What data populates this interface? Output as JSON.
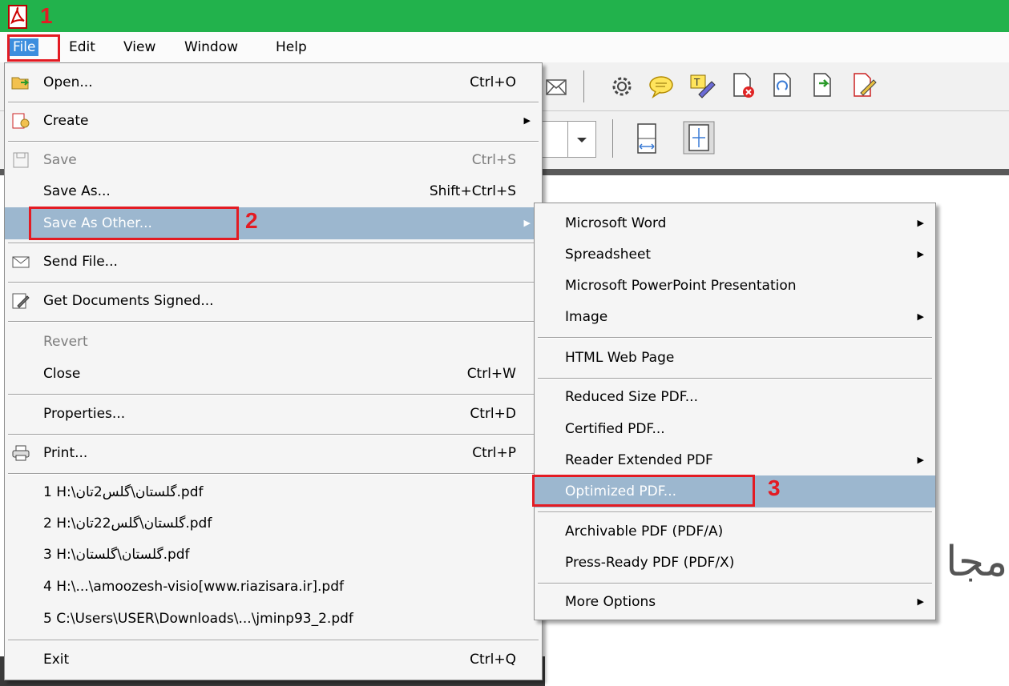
{
  "menubar": {
    "items": [
      {
        "label": "File"
      },
      {
        "label": "Edit"
      },
      {
        "label": "View"
      },
      {
        "label": "Window"
      },
      {
        "label": "Help"
      }
    ]
  },
  "file_menu": {
    "open": {
      "label": "Open...",
      "shortcut": "Ctrl+O"
    },
    "create": {
      "label": "Create"
    },
    "save": {
      "label": "Save",
      "shortcut": "Ctrl+S"
    },
    "save_as": {
      "label": "Save As...",
      "shortcut": "Shift+Ctrl+S"
    },
    "save_as_other": {
      "label": "Save As Other..."
    },
    "send_file": {
      "label": "Send File..."
    },
    "get_signed": {
      "label": "Get Documents Signed..."
    },
    "revert": {
      "label": "Revert"
    },
    "close": {
      "label": "Close",
      "shortcut": "Ctrl+W"
    },
    "properties": {
      "label": "Properties...",
      "shortcut": "Ctrl+D"
    },
    "print": {
      "label": "Print...",
      "shortcut": "Ctrl+P"
    },
    "recent": [
      "1 H:\\گلستان\\گلس2تان.pdf",
      "2 H:\\گلستان\\گلس22تان.pdf",
      "3 H:\\گلستان\\گلستان.pdf",
      "4 H:\\...\\amoozesh-visio[www.riazisara.ir].pdf",
      "5 C:\\Users\\USER\\Downloads\\...\\jminp93_2.pdf"
    ],
    "exit": {
      "label": "Exit",
      "shortcut": "Ctrl+Q"
    }
  },
  "submenu": {
    "word": "Microsoft Word",
    "spreadsheet": "Spreadsheet",
    "powerpoint": "Microsoft PowerPoint Presentation",
    "image": "Image",
    "html": "HTML Web Page",
    "reduced": "Reduced Size PDF...",
    "certified": "Certified PDF...",
    "reader_extended": "Reader Extended PDF",
    "optimized": "Optimized PDF...",
    "archivable": "Archivable PDF (PDF/A)",
    "press_ready": "Press-Ready PDF (PDF/X)",
    "more": "More Options"
  },
  "annotations": {
    "step1": "1",
    "step2": "2",
    "step3": "3"
  },
  "document": {
    "visible_text": "مجا"
  },
  "colors": {
    "titlebar": "#22b24c",
    "highlight": "#9cb7cf",
    "annotation": "#e31b23"
  }
}
